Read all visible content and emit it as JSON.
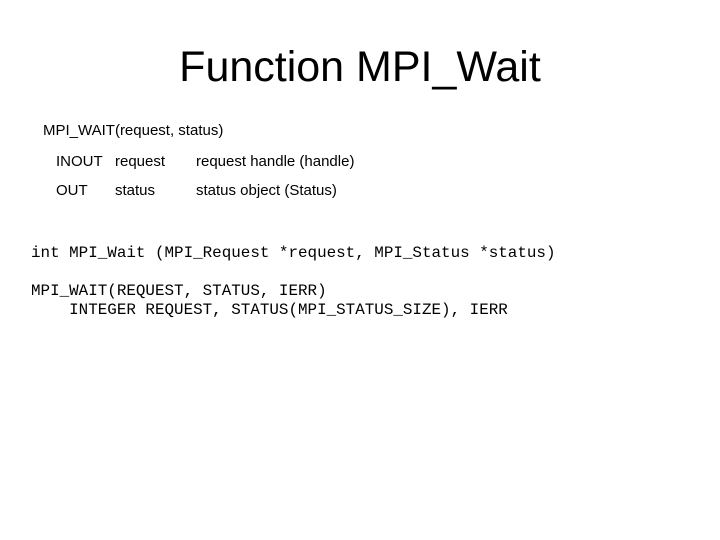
{
  "title": "Function MPI_Wait",
  "signature": "MPI_WAIT(request, status)",
  "params": [
    {
      "direction": "INOUT",
      "name": "request",
      "description": "request handle (handle)"
    },
    {
      "direction": "OUT",
      "name": "status",
      "description": "status object (Status)"
    }
  ],
  "c_binding": "int MPI_Wait (MPI_Request *request, MPI_Status *status)",
  "fortran_binding": [
    "MPI_WAIT(REQUEST, STATUS, IERR)",
    "    INTEGER REQUEST, STATUS(MPI_STATUS_SIZE), IERR"
  ]
}
